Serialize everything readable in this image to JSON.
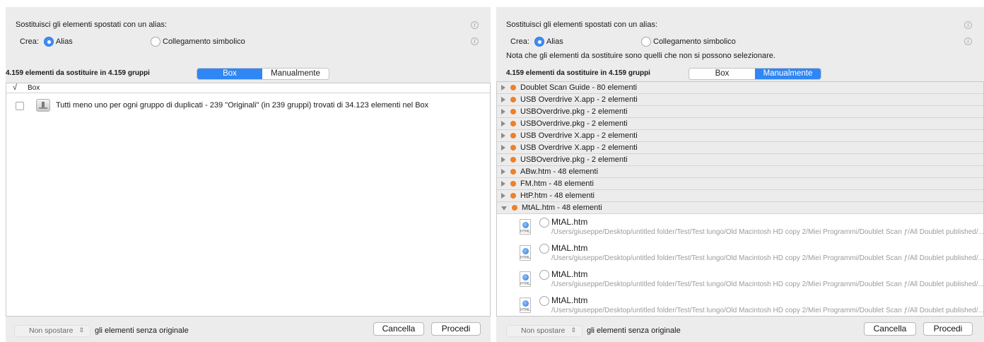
{
  "left": {
    "title": "Sostituisci gli elementi spostati con un alias:",
    "crea_label": "Crea:",
    "radio_alias": "Alias",
    "radio_symlink": "Collegamento simbolico",
    "info_glyph": "i",
    "count": "4.159 elementi da sostituire in 4.159 gruppi",
    "seg_box": "Box",
    "seg_manual": "Manualmente",
    "selected_segment": "Box",
    "header_check": "√",
    "header_col": "Box",
    "row_text": "Tutti meno uno per ogni gruppo di duplicati - 239 \"Originali\" (in 239 gruppi) trovati di 34.123 elementi nel Box",
    "popup_value": "Non spostare",
    "popup_suffix": "gli elementi senza originale",
    "cancel": "Cancella",
    "proceed": "Procedi"
  },
  "right": {
    "title": "Sostituisci gli elementi spostati con un alias:",
    "crea_label": "Crea:",
    "radio_alias": "Alias",
    "radio_symlink": "Collegamento simbolico",
    "info_glyph": "i",
    "note": "Nota che gli elementi da sostituire sono quelli che non si possono selezionare.",
    "count": "4.159 elementi da sostituire in 4.159 gruppi",
    "seg_box": "Box",
    "seg_manual": "Manualmente",
    "selected_segment": "Manualmente",
    "groups": [
      "Doublet Scan Guide - 80 elementi",
      "USB Overdrive X.app - 2 elementi",
      "USBOverdrive.pkg - 2 elementi",
      "USBOverdrive.pkg - 2 elementi",
      "USB Overdrive X.app - 2 elementi",
      "USB Overdrive X.app - 2 elementi",
      "USBOverdrive.pkg - 2 elementi",
      "ABw.htm - 48 elementi",
      "FM.htm - 48 elementi",
      "HtP.htm - 48 elementi",
      "MtAL.htm - 48 elementi"
    ],
    "file_ext": "HTML",
    "files": [
      {
        "name": "MtAL.htm",
        "path": "/Users/giuseppe/Desktop/untitled folder/Test/Test lungo/Old Macintosh HD copy 2/Miei Programmi/Doublet Scan ƒ/All Doublet published/..."
      },
      {
        "name": "MtAL.htm",
        "path": "/Users/giuseppe/Desktop/untitled folder/Test/Test lungo/Old Macintosh HD copy 2/Miei Programmi/Doublet Scan ƒ/All Doublet published/..."
      },
      {
        "name": "MtAL.htm",
        "path": "/Users/giuseppe/Desktop/untitled folder/Test/Test lungo/Old Macintosh HD copy 2/Miei Programmi/Doublet Scan ƒ/All Doublet published/..."
      },
      {
        "name": "MtAL.htm",
        "path": "/Users/giuseppe/Desktop/untitled folder/Test/Test lungo/Old Macintosh HD copy 2/Miei Programmi/Doublet Scan ƒ/All Doublet published/..."
      }
    ],
    "popup_value": "Non spostare",
    "popup_suffix": "gli elementi senza originale",
    "cancel": "Cancella",
    "proceed": "Procedi"
  },
  "colors": {
    "accent": "#2f86f4",
    "group_dot": "#f07f26",
    "panel_bg": "#ececec"
  }
}
